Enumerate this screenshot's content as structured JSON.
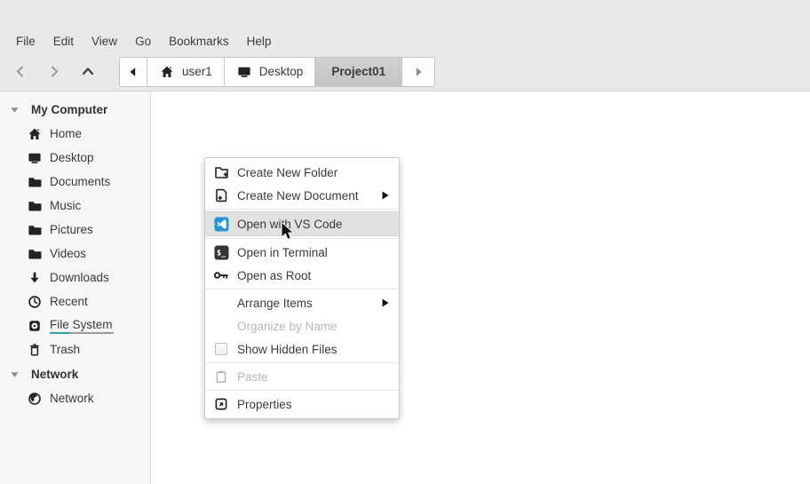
{
  "menubar": {
    "items": [
      {
        "label": "File"
      },
      {
        "label": "Edit"
      },
      {
        "label": "View"
      },
      {
        "label": "Go"
      },
      {
        "label": "Bookmarks"
      },
      {
        "label": "Help"
      }
    ]
  },
  "toolbar": {
    "nav": [
      {
        "name": "back",
        "icon": "chevron-left"
      },
      {
        "name": "forward",
        "icon": "chevron-right"
      },
      {
        "name": "up",
        "icon": "chevron-up"
      }
    ],
    "breadcrumb_scroll_left": {
      "icon": "tri-left"
    },
    "breadcrumbs": [
      {
        "icon": "home",
        "label": "user1",
        "active": false
      },
      {
        "icon": "desktop",
        "label": "Desktop",
        "active": false
      },
      {
        "icon": null,
        "label": "Project01",
        "active": true
      }
    ],
    "breadcrumb_scroll_right": {
      "icon": "tri-right"
    }
  },
  "sidebar": {
    "sections": [
      {
        "header": "My Computer",
        "expanded": true,
        "items": [
          {
            "icon": "home",
            "label": "Home"
          },
          {
            "icon": "desktop",
            "label": "Desktop"
          },
          {
            "icon": "folder",
            "label": "Documents"
          },
          {
            "icon": "folder",
            "label": "Music"
          },
          {
            "icon": "folder",
            "label": "Pictures"
          },
          {
            "icon": "folder",
            "label": "Videos"
          },
          {
            "icon": "download",
            "label": "Downloads"
          },
          {
            "icon": "clock",
            "label": "Recent"
          },
          {
            "icon": "drive",
            "label": "File System",
            "usage_bar": true
          },
          {
            "icon": "trash",
            "label": "Trash"
          }
        ]
      },
      {
        "header": "Network",
        "expanded": true,
        "items": [
          {
            "icon": "globe",
            "label": "Network"
          }
        ]
      }
    ]
  },
  "context_menu": {
    "items": [
      {
        "type": "item",
        "icon": "folder-plus",
        "label": "Create New Folder"
      },
      {
        "type": "item",
        "icon": "file-plus",
        "label": "Create New Document",
        "submenu": true
      },
      {
        "type": "separator"
      },
      {
        "type": "item",
        "icon": "vscode",
        "label": "Open with VS Code",
        "highlighted": true
      },
      {
        "type": "separator"
      },
      {
        "type": "item",
        "icon": "terminal",
        "label": "Open in Terminal"
      },
      {
        "type": "item",
        "icon": "key",
        "label": "Open as Root"
      },
      {
        "type": "separator"
      },
      {
        "type": "item",
        "icon": null,
        "label": "Arrange Items",
        "submenu": true
      },
      {
        "type": "item",
        "icon": null,
        "label": "Organize by Name",
        "disabled": true
      },
      {
        "type": "item",
        "icon": "checkbox",
        "label": "Show Hidden Files",
        "checkbox": true,
        "checked": false
      },
      {
        "type": "separator"
      },
      {
        "type": "item",
        "icon": "clipboard",
        "label": "Paste",
        "disabled": true
      },
      {
        "type": "separator"
      },
      {
        "type": "item",
        "icon": "properties",
        "label": "Properties"
      }
    ]
  },
  "colors": {
    "vscode_blue": "#2598d3",
    "usage_teal": "#2aa5a5",
    "highlight": "#e1e1e0",
    "window_bg": "#eae9e8",
    "sidebar_bg": "#f6f6f6"
  }
}
